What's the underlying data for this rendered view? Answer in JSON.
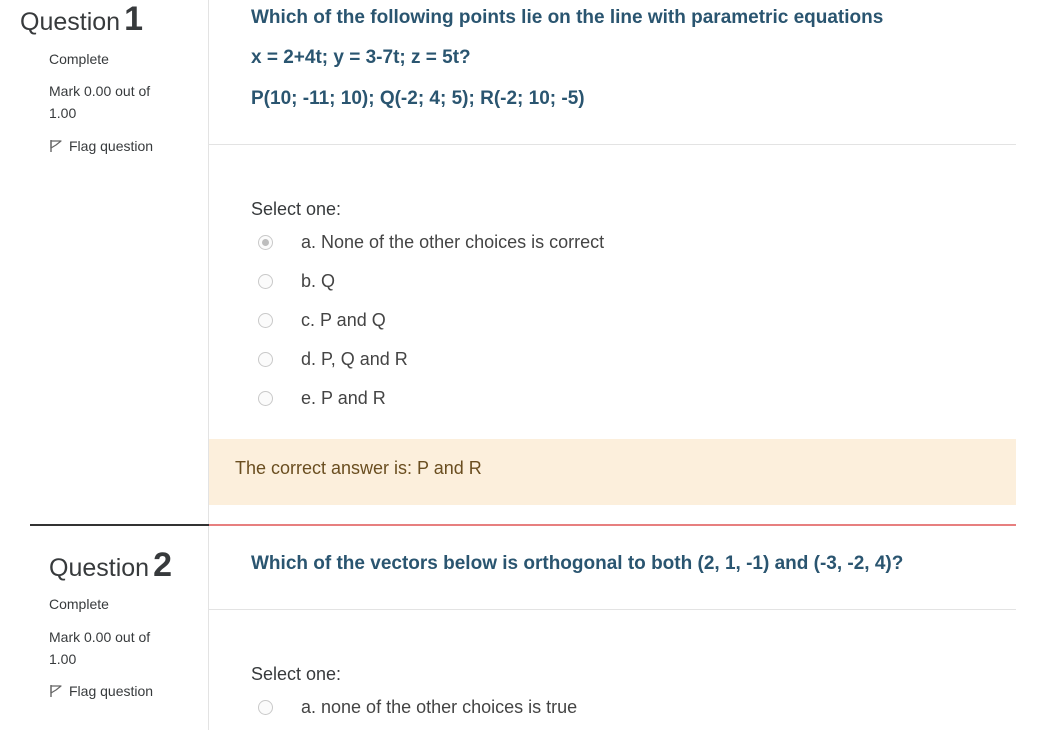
{
  "questions": [
    {
      "label": "Question",
      "number": "1",
      "state": "Complete",
      "grade": "Mark 0.00 out of 1.00",
      "flag_label": "Flag question",
      "text_line1": "Which of the following points lie on the line with parametric equations",
      "text_line2": "x = 2+4t; y = 3-7t; z = 5t?",
      "text_line3": "P(10; -11; 10); Q(-2; 4; 5); R(-2; 10; -5)",
      "prompt": "Select one:",
      "options": [
        {
          "label": "a. None of the other choices is correct",
          "checked": true
        },
        {
          "label": "b. Q",
          "checked": false
        },
        {
          "label": "c. P and Q",
          "checked": false
        },
        {
          "label": "d. P, Q and R",
          "checked": false
        },
        {
          "label": "e. P and R",
          "checked": false
        }
      ],
      "feedback": "The correct answer is: P and R"
    },
    {
      "label": "Question",
      "number": "2",
      "state": "Complete",
      "grade": "Mark 0.00 out of 1.00",
      "flag_label": "Flag question",
      "text_line1": "Which of the vectors below is orthogonal to both (2, 1, -1) and (-3, -2, 4)?",
      "prompt": "Select one:",
      "options": [
        {
          "label": "a. none of the other choices is true",
          "checked": false
        }
      ]
    }
  ],
  "colors": {
    "question_text": "#2a5570",
    "feedback_bg": "#fcefdc",
    "separator_red": "#e77f7f",
    "separator_dark": "#333333"
  }
}
